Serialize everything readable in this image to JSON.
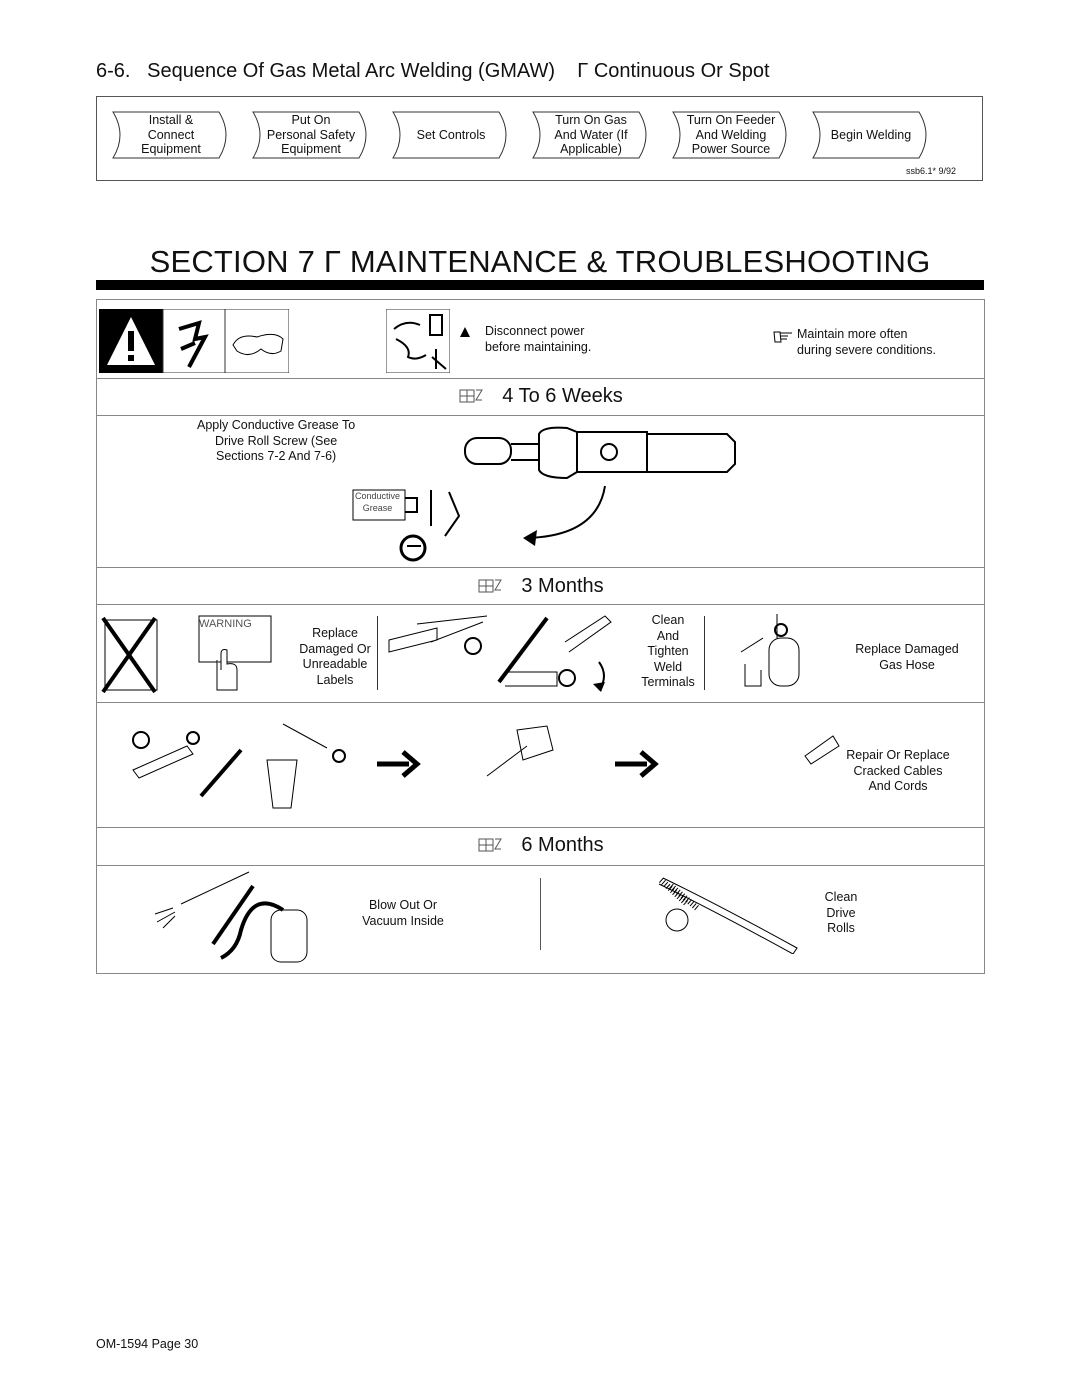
{
  "heading_66": "6-6.   Sequence Of Gas Metal Arc Welding (GMAW)    Γ Continuous Or Spot",
  "sequence": {
    "steps": [
      "Install &\nConnect\nEquipment",
      "Put On\nPersonal Safety\nEquipment",
      "Set Controls",
      "Turn On Gas\nAnd Water (If\nApplicable)",
      "Turn On Feeder\nAnd Welding\nPower Source",
      "Begin Welding"
    ],
    "ref": "ssb6.1* 9/92"
  },
  "section_title": "SECTION 7 Γ MAINTENANCE & TROUBLESHOOTING",
  "safety": {
    "warning_text": "Disconnect  power\nbefore maintaining.",
    "note_text": "Maintain more often\nduring severe conditions.",
    "icons": [
      "warning-triangle-icon",
      "electric-shock-icon",
      "safety-glasses-icon",
      "disconnect-power-icon",
      "pointing-hand-icon"
    ]
  },
  "periods": [
    {
      "title": "4 To 6 Weeks",
      "items": [
        {
          "label": "Apply Conductive Grease To\nDrive Roll Screw (See\nSections 7-2 And 7-6)"
        },
        {
          "label": "Conductive\nGrease"
        }
      ]
    },
    {
      "title": "3 Months",
      "items": [
        {
          "label": "Replace\nDamaged Or\nUnreadable\nLabels"
        },
        {
          "label": "Clean\nAnd\nTighten\nWeld\nTerminals"
        },
        {
          "label": "Replace Damaged\nGas Hose"
        },
        {
          "label": "Repair Or Replace\nCracked Cables\nAnd Cords"
        }
      ],
      "label_text": "WARNING"
    },
    {
      "title": "6 Months",
      "items": [
        {
          "label": "Blow Out Or\nVacuum Inside"
        },
        {
          "label": "Clean\nDrive\nRolls"
        }
      ]
    }
  ],
  "footer": "OM-1594 Page 30"
}
